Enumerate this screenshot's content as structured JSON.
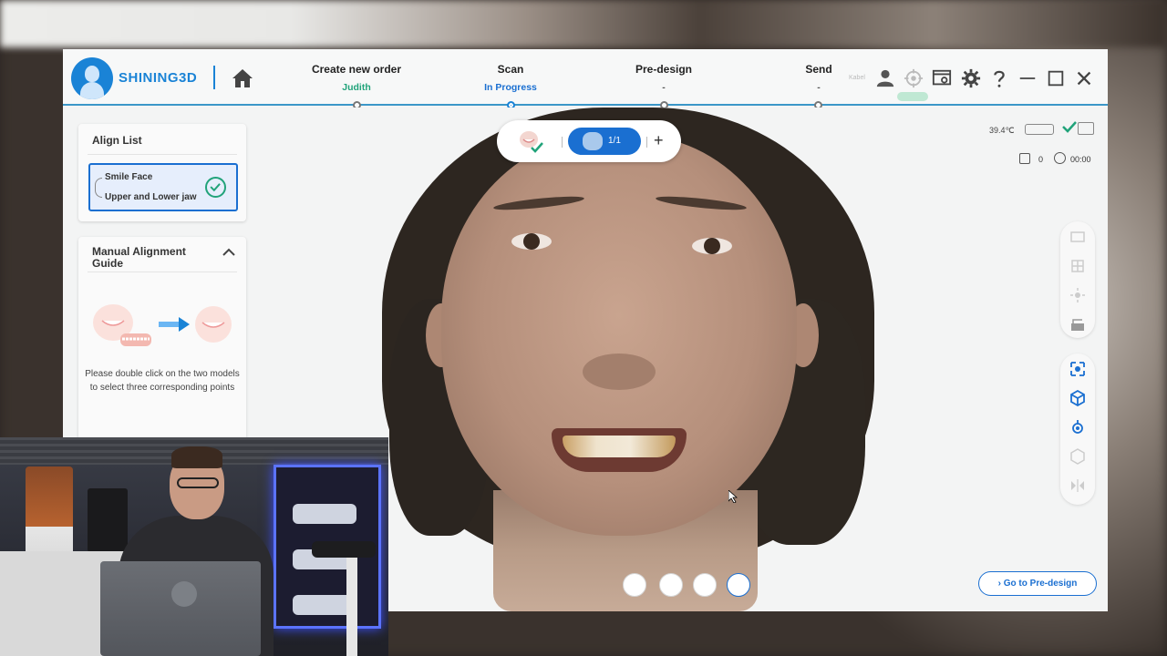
{
  "header": {
    "brand": "SHINING3D",
    "steps": [
      {
        "title": "Create new order",
        "status": "Judith",
        "color": "#21a37a"
      },
      {
        "title": "Scan",
        "status": "In Progress",
        "color": "#1a6fd1"
      },
      {
        "title": "Pre-design",
        "status": "-",
        "color": "#555555"
      },
      {
        "title": "Send",
        "status": "-",
        "color": "#555555"
      }
    ],
    "kabel_label": "Kabel",
    "icons": [
      "home-icon",
      "user-icon",
      "target-icon",
      "screenshot-icon",
      "gear-icon",
      "help-icon",
      "minimize-icon",
      "maximize-icon",
      "close-icon"
    ]
  },
  "align_list": {
    "title": "Align List",
    "item_line1": "Smile Face",
    "item_line2": "Upper and Lower jaw"
  },
  "guide": {
    "title": "Manual Alignment Guide",
    "text": "Please double click on the two models to select three corresponding points"
  },
  "scan_tabs": {
    "count": "1/1",
    "add": "+"
  },
  "status": {
    "temperature": "39.4℃",
    "count": "0",
    "timer": "00:00"
  },
  "actions": {
    "go_pre_design": "Go to Pre-design"
  },
  "colors": {
    "accent": "#1a6fd1",
    "brand": "#1a83d6",
    "success": "#21a37a"
  }
}
